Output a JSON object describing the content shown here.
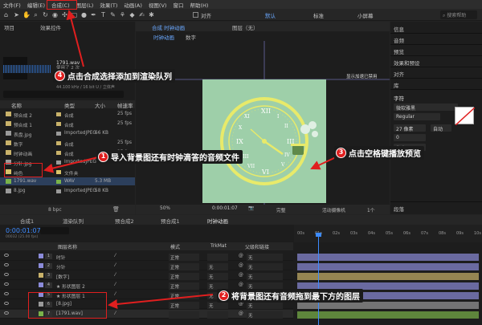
{
  "menu": [
    "文件(F)",
    "编辑(E)",
    "合成(C)",
    "图层(L)",
    "效果(T)",
    "动画(A)",
    "视图(V)",
    "窗口",
    "帮助(H)"
  ],
  "toolbar": {
    "snap": "对齐",
    "ws_default": "默认",
    "ws_std": "标准",
    "ws_small": "小屏幕",
    "search": "搜索帮助"
  },
  "project": {
    "tab_project": "项目",
    "tab_effects": "效果控件",
    "file": "1791.wav",
    "used": "使用了 2 次",
    "audio_info": "44.100 kHz / 16 bit U / 立体声",
    "columns": {
      "name": "名称",
      "type": "类型",
      "size": "大小",
      "fps": "帧速率"
    },
    "items": [
      {
        "name": "预合成 2",
        "type": "合成",
        "size": "",
        "fps": "25 fps",
        "color": "#c9b26a"
      },
      {
        "name": "预合成 1",
        "type": "合成",
        "size": "",
        "fps": "25 fps",
        "color": "#c9b26a"
      },
      {
        "name": "表盘.jpg",
        "type": "ImportedJPEG",
        "size": "66 KB",
        "fps": "",
        "color": "#9a9a9a"
      },
      {
        "name": "数字",
        "type": "合成",
        "size": "",
        "fps": "25 fps",
        "color": "#c9b26a"
      },
      {
        "name": "时钟动画",
        "type": "合成",
        "size": "",
        "fps": "25 fps",
        "color": "#c9b26a"
      },
      {
        "name": "分针.jpg",
        "type": "ImportedJPEG",
        "size": "",
        "fps": "",
        "color": "#9a9a9a"
      },
      {
        "name": "纯色",
        "type": "文件夹",
        "size": "",
        "fps": "",
        "color": "#d9c36a"
      },
      {
        "name": "1791.wav",
        "type": "WAV",
        "size": "5.3 MB",
        "fps": "",
        "color": "#7ab34a"
      },
      {
        "name": "8.jpg",
        "type": "ImportedJPEG",
        "size": "58 KB",
        "fps": "",
        "color": "#9a9a9a"
      }
    ],
    "bpc": "8 bpc"
  },
  "viewer": {
    "tab_comp": "合成",
    "comp_name": "时钟动画",
    "tab_layer": "图层（无）",
    "sub_tabs": [
      "时钟动画",
      "数字"
    ],
    "hint": "显示加速已禁用",
    "zoom": "50%",
    "timecode": "0:00:01:07",
    "quality": "完整",
    "camera": "活动摄像机",
    "views": "1个"
  },
  "right_panel": [
    "信息",
    "音频",
    "预览",
    "效果和预设",
    "对齐",
    "库",
    "字符",
    "段落"
  ],
  "character": {
    "font": "微软雅黑",
    "style": "Regular",
    "size": "27 像素",
    "leading": "自动",
    "tracking": "0",
    "stroke": "像素"
  },
  "timeline": {
    "tabs": [
      "合成1",
      "渲染队列",
      "预合成2",
      "预合成1",
      "时钟动画"
    ],
    "time": "0:00:01:07",
    "frames": "00032 (25.00 fps)",
    "columns": {
      "name": "图层名称",
      "mode": "模式",
      "trkmat": "TrkMat",
      "parent": "父级和链接"
    },
    "layers": [
      {
        "num": "1",
        "name": "时针",
        "mode": "正常",
        "trk": "",
        "parent": "无",
        "color": "#8b8bd9"
      },
      {
        "num": "2",
        "name": "分针",
        "mode": "正常",
        "trk": "无",
        "parent": "无",
        "color": "#8b8bd9"
      },
      {
        "num": "3",
        "name": "[数字]",
        "mode": "正常",
        "trk": "无",
        "parent": "无",
        "color": "#c9b26a"
      },
      {
        "num": "4",
        "name": "★ 形状图层 2",
        "mode": "正常",
        "trk": "无",
        "parent": "无",
        "color": "#8b8bd9"
      },
      {
        "num": "5",
        "name": "★ 形状图层 1",
        "mode": "正常",
        "trk": "无",
        "parent": "无",
        "color": "#8b8bd9"
      },
      {
        "num": "6",
        "name": "[8.jpg]",
        "mode": "正常",
        "trk": "无",
        "parent": "无",
        "color": "#9a9a9a"
      },
      {
        "num": "7",
        "name": "[1791.wav]",
        "mode": "",
        "trk": "",
        "parent": "无",
        "color": "#7ab34a"
      }
    ],
    "ticks": [
      "00s",
      "01s",
      "02s",
      "03s",
      "04s",
      "05s",
      "06s",
      "07s",
      "08s",
      "09s",
      "10s"
    ]
  },
  "annotations": [
    {
      "num": "1",
      "text": "导入背景图还有时钟滴答的音频文件"
    },
    {
      "num": "2",
      "text": "将背景图还有音频拖到最下方的图层"
    },
    {
      "num": "3",
      "text": "点击空格键播放预览"
    },
    {
      "num": "4",
      "text": "点击合成选择添加到渲染队列"
    }
  ],
  "colors": {
    "accent": "#3d8bff",
    "annotation": "#e01f1f",
    "canvas": "#9ecfa9"
  }
}
